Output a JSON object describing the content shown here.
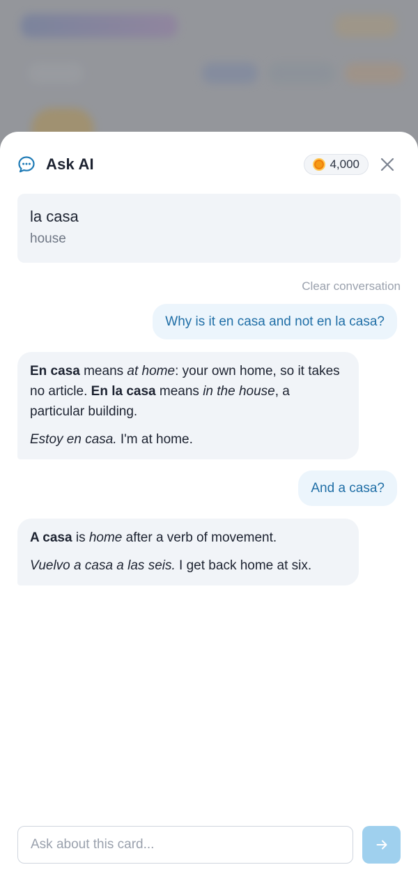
{
  "sheet": {
    "title": "Ask AI",
    "coins": "4,000",
    "icons": {
      "chat": "chat-bubble-icon",
      "coin": "coin-icon",
      "close": "close-icon",
      "send": "arrow-right-icon"
    }
  },
  "card": {
    "word": "la casa",
    "translation": "house"
  },
  "clear_label": "Clear conversation",
  "messages": {
    "user1": "Why is it en casa and not en la casa?",
    "ai1": {
      "p1": {
        "b1": "En casa",
        "t1": " means ",
        "i1": "at home",
        "t2": ": your own home, so it takes no article. ",
        "b2": "En la casa",
        "t3": " means ",
        "i2": "in the house",
        "t4": ", a particular building."
      },
      "p2": {
        "i1": "Estoy en casa.",
        "t1": " I'm at home."
      }
    },
    "user2": "And a casa?",
    "ai2": {
      "p1": {
        "b1": "A casa",
        "t1": " is ",
        "i1": "home",
        "t2": " after a verb of movement."
      },
      "p2": {
        "i1": "Vuelvo a casa a las seis.",
        "t1": " I get back home at six."
      }
    }
  },
  "composer": {
    "placeholder": "Ask about this card..."
  },
  "colors": {
    "accent": "#1f6ea6",
    "send_button": "#9fd0ee",
    "user_bubble": "#ecf5fc",
    "ai_bubble": "#f1f4f8"
  }
}
